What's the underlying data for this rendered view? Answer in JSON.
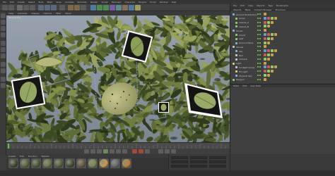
{
  "main_menu": [
    "File",
    "Edit",
    "Create",
    "Select",
    "Tools",
    "Mesh",
    "Snap",
    "Animate",
    "Simulate",
    "Render",
    "Sculpt",
    "MoGraph",
    "Character",
    "Plugins",
    "Script",
    "Window",
    "Help"
  ],
  "viewport": {
    "menu": [
      "View",
      "Cameras",
      "Display",
      "Options",
      "Filter",
      "Panel"
    ],
    "label": "Perspective"
  },
  "object_manager": {
    "menu": [
      "File",
      "Edit",
      "View",
      "Objects",
      "Tags",
      "Bookmarks"
    ],
    "tabs": [
      "Objects",
      "Takes",
      "Content Browser",
      "Structure"
    ],
    "objects": [
      {
        "name": "Ground Distribution",
        "color": "#7fb3e0"
      },
      {
        "name": "Grass",
        "color": "#8fd06a"
      },
      {
        "name": "Leaves_A",
        "color": "#8fd06a"
      },
      {
        "name": "Leaves_B",
        "color": "#8fd06a"
      },
      {
        "name": "Cloner",
        "color": "#7fb3e0"
      },
      {
        "name": "Clover",
        "color": "#8fd06a"
      },
      {
        "name": "Leaf",
        "color": "#8fd06a"
      },
      {
        "name": "Ground Plane",
        "color": "#7fb3e0"
      },
      {
        "name": "Stones",
        "color": "#c8c8c8"
      },
      {
        "name": "Sky",
        "color": "#7fb3e0"
      },
      {
        "name": "Null",
        "color": "#c8c8c8"
      },
      {
        "name": "Camera",
        "color": "#c8c8c8"
      },
      {
        "name": "Light",
        "color": "#e0d070"
      },
      {
        "name": "Sunlight Group",
        "color": "#c8c8c8"
      },
      {
        "name": "Fill Light",
        "color": "#e0d070"
      },
      {
        "name": "Physical Sky",
        "color": "#7fb3e0"
      },
      {
        "name": "Polygon",
        "color": "#8fd06a"
      }
    ]
  },
  "attribute_manager": {
    "menu": [
      "Mode",
      "Edit",
      "User Data"
    ]
  },
  "material_manager": {
    "menu": [
      "Create",
      "Edit",
      "Function",
      "Texture"
    ],
    "materials": [
      {
        "color": "#3b4a2a"
      },
      {
        "color": "#5a6b38"
      },
      {
        "color": "#4a5a30"
      },
      {
        "color": "#6b7a40"
      },
      {
        "color": "#54643a"
      },
      {
        "color": "#3f4f2b"
      },
      {
        "color": "#6a5a3a"
      },
      {
        "color": "#7a8a48"
      },
      {
        "color": "#d09a40"
      },
      {
        "color": "#6a6a6a"
      },
      {
        "color": "#c08030"
      }
    ]
  },
  "colors": {
    "sky": "#8f9aa6",
    "foliage_dark": "#3c4a24",
    "foliage_mid": "#6f7d3e",
    "foliage_light": "#b9bb7e",
    "accent_orange": "#d08a30"
  }
}
